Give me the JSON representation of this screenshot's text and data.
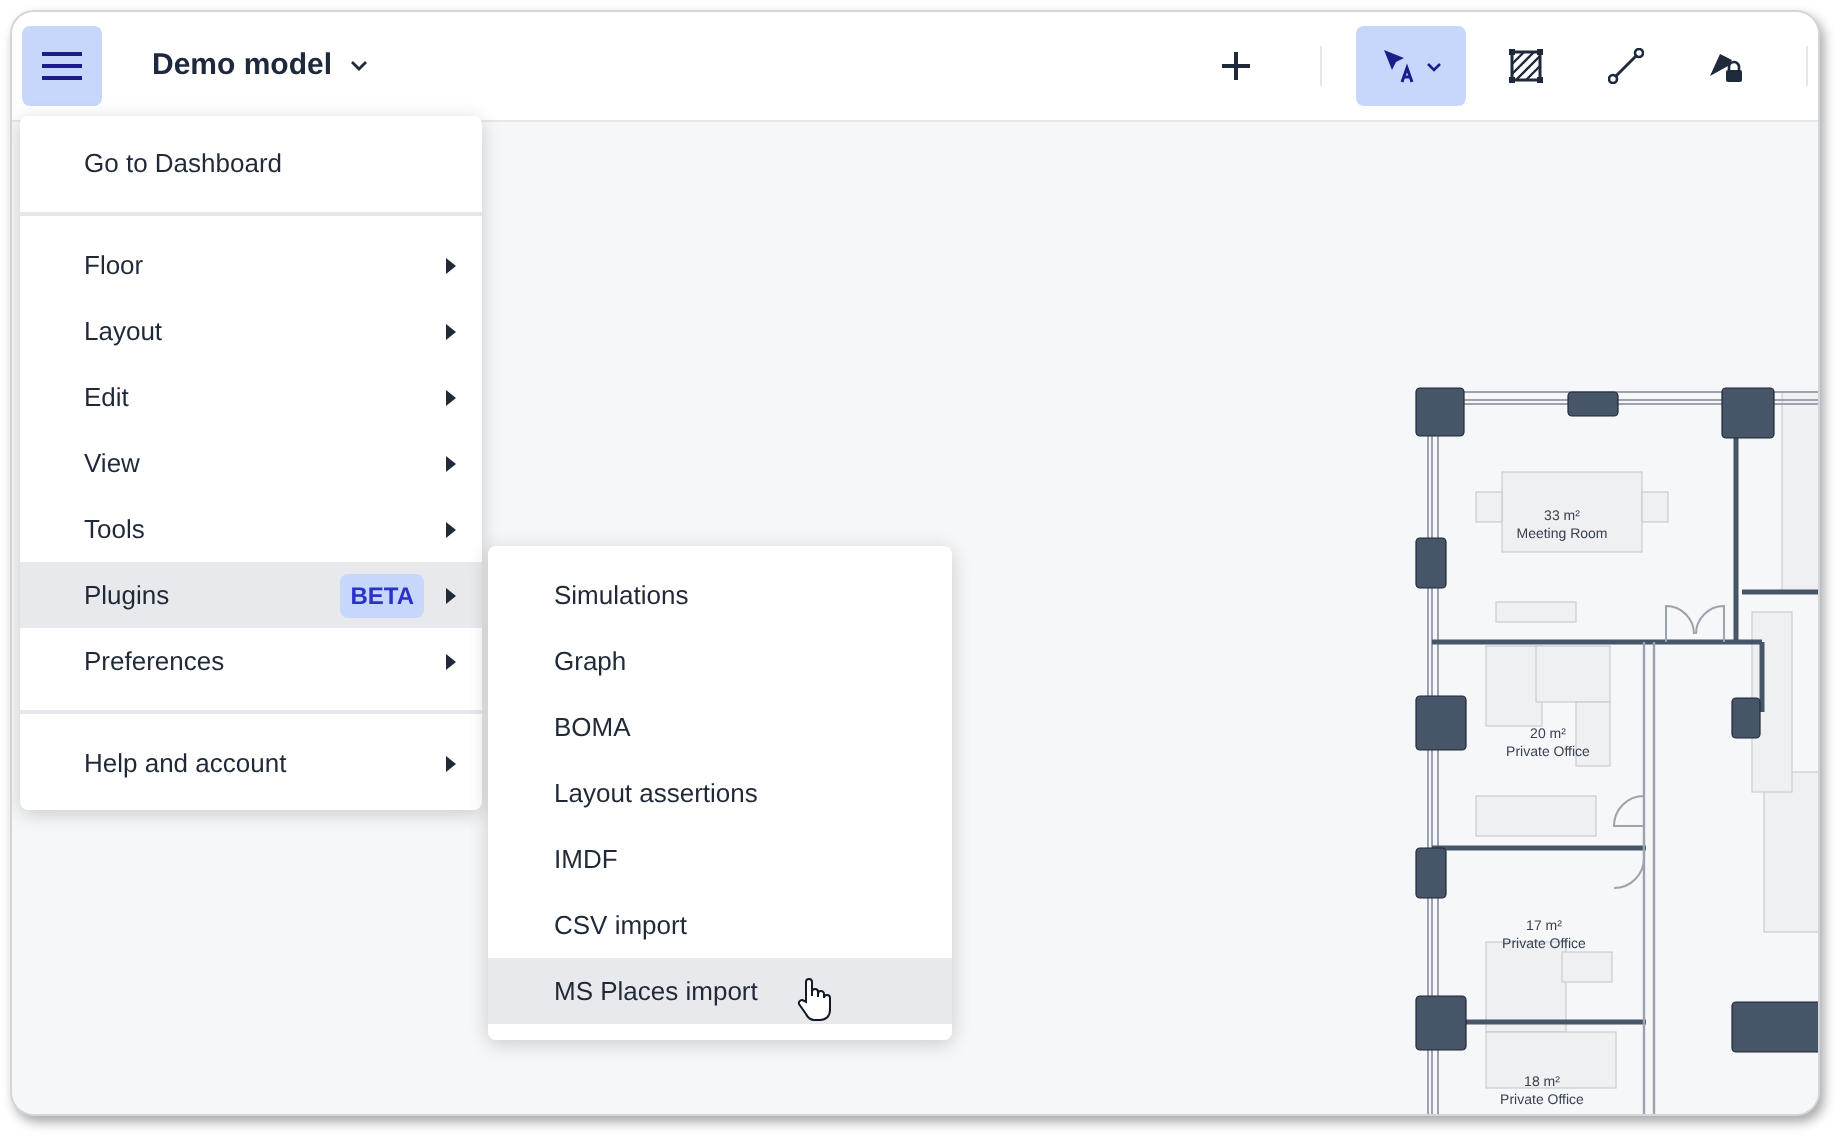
{
  "header": {
    "menu_button": {
      "expanded": true
    },
    "title": "Demo model",
    "tools": [
      {
        "kind": "add",
        "selected": false
      },
      {
        "kind": "select",
        "selected": true
      },
      {
        "kind": "area",
        "selected": false
      },
      {
        "kind": "line",
        "selected": false
      },
      {
        "kind": "fill",
        "selected": false
      }
    ]
  },
  "main_menu": {
    "groups": [
      [
        {
          "label": "Go to Dashboard",
          "submenu": false,
          "selected": false
        }
      ],
      [
        {
          "label": "Floor",
          "submenu": true,
          "selected": false
        },
        {
          "label": "Layout",
          "submenu": true,
          "selected": false
        },
        {
          "label": "Edit",
          "submenu": true,
          "selected": false
        },
        {
          "label": "View",
          "submenu": true,
          "selected": false
        },
        {
          "label": "Tools",
          "submenu": true,
          "selected": false
        },
        {
          "label": "Plugins",
          "badge": "BETA",
          "submenu": true,
          "selected": true
        },
        {
          "label": "Preferences",
          "submenu": true,
          "selected": false
        }
      ],
      [
        {
          "label": "Help and account",
          "submenu": true,
          "selected": false
        }
      ]
    ]
  },
  "plugins_submenu": {
    "items": [
      {
        "label": "Simulations",
        "selected": false
      },
      {
        "label": "Graph",
        "selected": false
      },
      {
        "label": "BOMA",
        "selected": false
      },
      {
        "label": "Layout assertions",
        "selected": false
      },
      {
        "label": "IMDF",
        "selected": false
      },
      {
        "label": "CSV import",
        "selected": false
      },
      {
        "label": "MS Places import",
        "selected": true
      }
    ]
  },
  "floor_plan": {
    "rooms": [
      {
        "area": "33 m²",
        "name": "Meeting Room"
      },
      {
        "area": "20 m²",
        "name": "Private Office"
      },
      {
        "area": "17 m²",
        "name": "Private Office"
      },
      {
        "area": "18 m²",
        "name": "Private Office"
      }
    ]
  }
}
